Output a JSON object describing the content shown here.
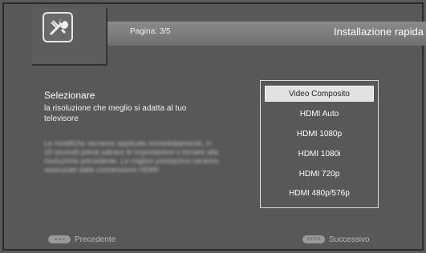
{
  "header": {
    "page_label": "Pagina: 3/5",
    "title": "Installazione rapida"
  },
  "prompt": {
    "title": "Selezionare",
    "description": "la risoluzione che meglio si adatta al tuo televisore",
    "note": "Le modifiche verranno applicate immediatamente, in 15 secondi potrai salvare le impostazioni o tornare alla risoluzione precedente. Le migliori prestazioni saranno assicurate dalla connessione HDMI!"
  },
  "resolution_options": [
    {
      "label": "Video Composito",
      "selected": true
    },
    {
      "label": "HDMI Auto",
      "selected": false
    },
    {
      "label": "HDMI 1080p",
      "selected": false
    },
    {
      "label": "HDMI 1080i",
      "selected": false
    },
    {
      "label": "HDMI 720p",
      "selected": false
    },
    {
      "label": "HDMI 480p/576p",
      "selected": false
    }
  ],
  "footer": {
    "prev_key": "◄◄◄",
    "prev_label": "Precedente",
    "next_key": "ENTER",
    "next_label": "Successivo"
  },
  "icons": {
    "logo": "settings-wrench-icon"
  }
}
